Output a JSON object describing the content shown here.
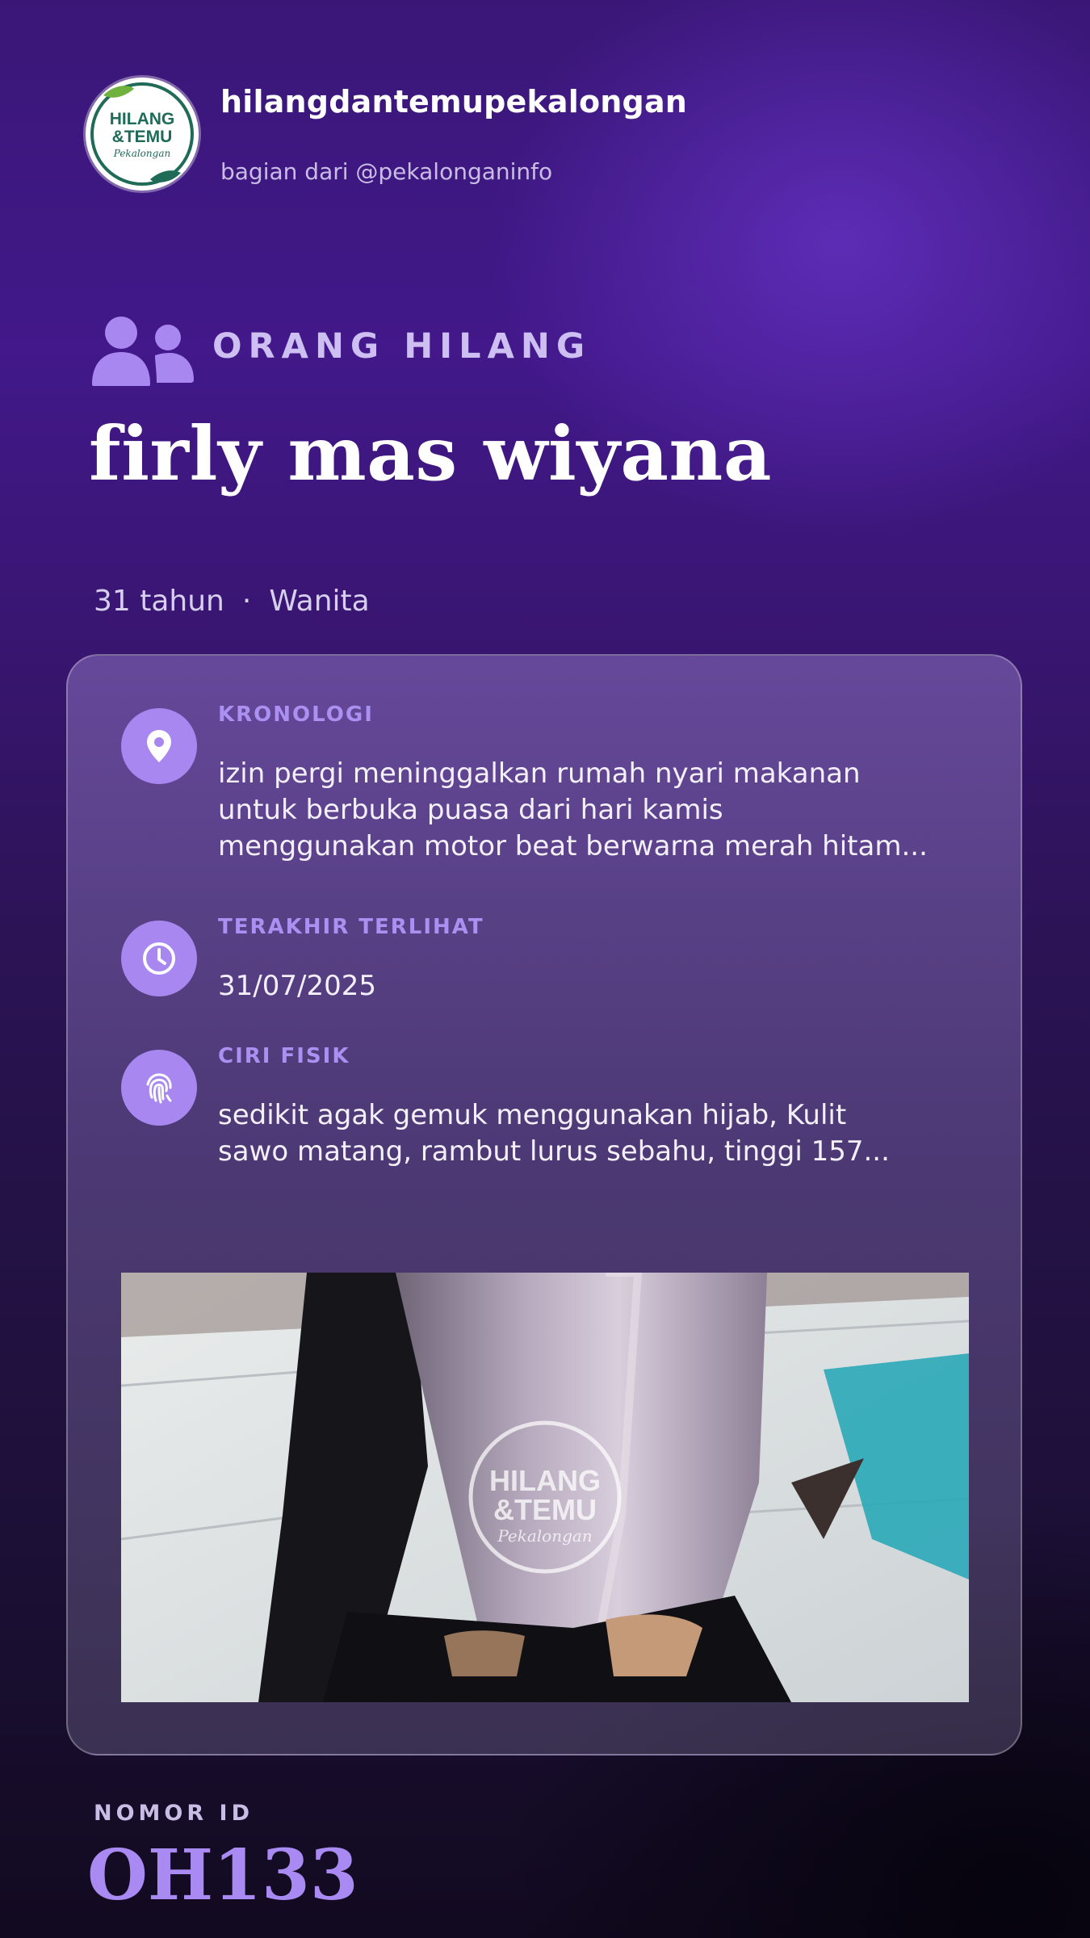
{
  "header": {
    "logo": {
      "icon": "hilang-temu-logo",
      "line1": "HILANG",
      "line2": "&TEMU",
      "line3": "Pekalongan"
    },
    "account_name": "hilangdantemupekalongan",
    "account_sub": "bagian dari @pekalonganinfo"
  },
  "category": {
    "icon": "users-icon",
    "label": "ORANG HILANG"
  },
  "person": {
    "name": "firly mas wiyana",
    "age": "31 tahun",
    "separator": "·",
    "gender": "Wanita"
  },
  "details": [
    {
      "icon": "location-pin-icon",
      "label": "KRONOLOGI",
      "lines": [
        "izin pergi meninggalkan rumah nyari makanan",
        "untuk berbuka puasa dari hari kamis",
        "menggunakan motor beat berwarna merah hitam..."
      ]
    },
    {
      "icon": "clock-icon",
      "label": "TERAKHIR TERLIHAT",
      "lines": [
        "31/07/2025"
      ]
    },
    {
      "icon": "fingerprint-icon",
      "label": "CIRI FISIK",
      "lines": [
        "sedikit agak gemuk menggunakan hijab, Kulit",
        "sawo matang, rambut lurus sebahu, tinggi 157..."
      ]
    }
  ],
  "photo": {
    "watermark_line1": "HILANG",
    "watermark_line2": "&TEMU",
    "watermark_line3": "Pekalongan"
  },
  "id": {
    "label": "NOMOR ID",
    "value": "OH133"
  },
  "colors": {
    "accent": "#a888f0",
    "label": "#ab90f2",
    "background": "#3a1777"
  }
}
